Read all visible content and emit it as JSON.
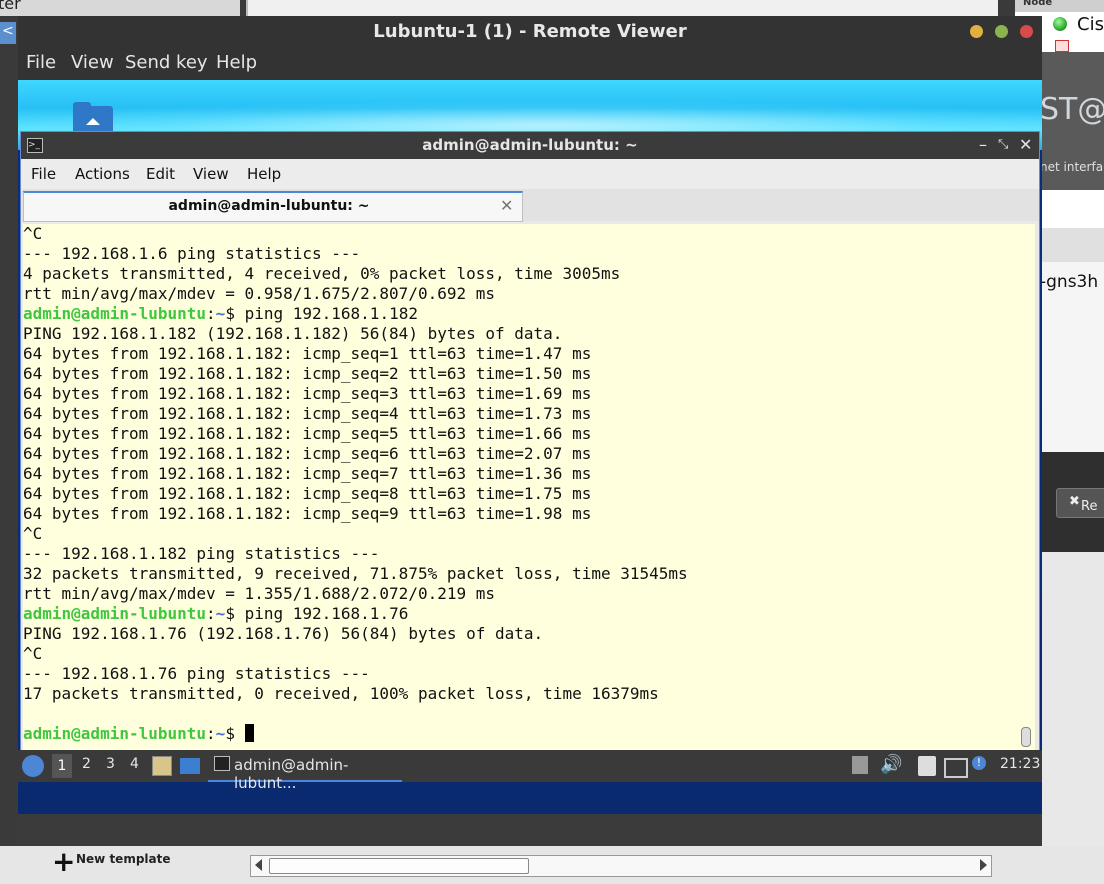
{
  "background": {
    "left_fragment_text": "ter",
    "node_header": "Node",
    "node_item": "Cis",
    "st_text": "ST@",
    "net_iface_text": "net interfa",
    "gns_text": "-gns3h",
    "r_button": "Re",
    "new_template": "New template"
  },
  "viewer": {
    "title": "Lubuntu-1 (1) - Remote Viewer",
    "menu": [
      "File",
      "View",
      "Send key",
      "Help"
    ]
  },
  "terminal": {
    "title": "admin@admin-lubuntu: ~",
    "menu": [
      "File",
      "Actions",
      "Edit",
      "View",
      "Help"
    ],
    "tab_label": "admin@admin-lubuntu: ~",
    "prompt_user": "admin@admin-lubuntu",
    "prompt_path": "~",
    "lines": [
      {
        "t": "out",
        "text": "^C"
      },
      {
        "t": "out",
        "text": "--- 192.168.1.6 ping statistics ---"
      },
      {
        "t": "out",
        "text": "4 packets transmitted, 4 received, 0% packet loss, time 3005ms"
      },
      {
        "t": "out",
        "text": "rtt min/avg/max/mdev = 0.958/1.675/2.807/0.692 ms"
      },
      {
        "t": "cmd",
        "text": "ping 192.168.1.182"
      },
      {
        "t": "out",
        "text": "PING 192.168.1.182 (192.168.1.182) 56(84) bytes of data."
      },
      {
        "t": "out",
        "text": "64 bytes from 192.168.1.182: icmp_seq=1 ttl=63 time=1.47 ms"
      },
      {
        "t": "out",
        "text": "64 bytes from 192.168.1.182: icmp_seq=2 ttl=63 time=1.50 ms"
      },
      {
        "t": "out",
        "text": "64 bytes from 192.168.1.182: icmp_seq=3 ttl=63 time=1.69 ms"
      },
      {
        "t": "out",
        "text": "64 bytes from 192.168.1.182: icmp_seq=4 ttl=63 time=1.73 ms"
      },
      {
        "t": "out",
        "text": "64 bytes from 192.168.1.182: icmp_seq=5 ttl=63 time=1.66 ms"
      },
      {
        "t": "out",
        "text": "64 bytes from 192.168.1.182: icmp_seq=6 ttl=63 time=2.07 ms"
      },
      {
        "t": "out",
        "text": "64 bytes from 192.168.1.182: icmp_seq=7 ttl=63 time=1.36 ms"
      },
      {
        "t": "out",
        "text": "64 bytes from 192.168.1.182: icmp_seq=8 ttl=63 time=1.75 ms"
      },
      {
        "t": "out",
        "text": "64 bytes from 192.168.1.182: icmp_seq=9 ttl=63 time=1.98 ms"
      },
      {
        "t": "out",
        "text": "^C"
      },
      {
        "t": "out",
        "text": "--- 192.168.1.182 ping statistics ---"
      },
      {
        "t": "out",
        "text": "32 packets transmitted, 9 received, 71.875% packet loss, time 31545ms"
      },
      {
        "t": "out",
        "text": "rtt min/avg/max/mdev = 1.355/1.688/2.072/0.219 ms"
      },
      {
        "t": "cmd",
        "text": "ping 192.168.1.76"
      },
      {
        "t": "out",
        "text": "PING 192.168.1.76 (192.168.1.76) 56(84) bytes of data."
      },
      {
        "t": "out",
        "text": "^C"
      },
      {
        "t": "out",
        "text": "--- 192.168.1.76 ping statistics ---"
      },
      {
        "t": "out",
        "text": "17 packets transmitted, 0 received, 100% packet loss, time 16379ms"
      },
      {
        "t": "out",
        "text": ""
      },
      {
        "t": "cur",
        "text": ""
      }
    ]
  },
  "panel": {
    "desktops": [
      "1",
      "2",
      "3",
      "4"
    ],
    "task_label": "admin@admin-lubunt...",
    "clock": "21:23"
  },
  "colors": {
    "prompt_user": "#3fc83f",
    "prompt_path": "#4a6fe0",
    "terminal_bg": "#ffffdd",
    "accent": "#4e86d6"
  }
}
